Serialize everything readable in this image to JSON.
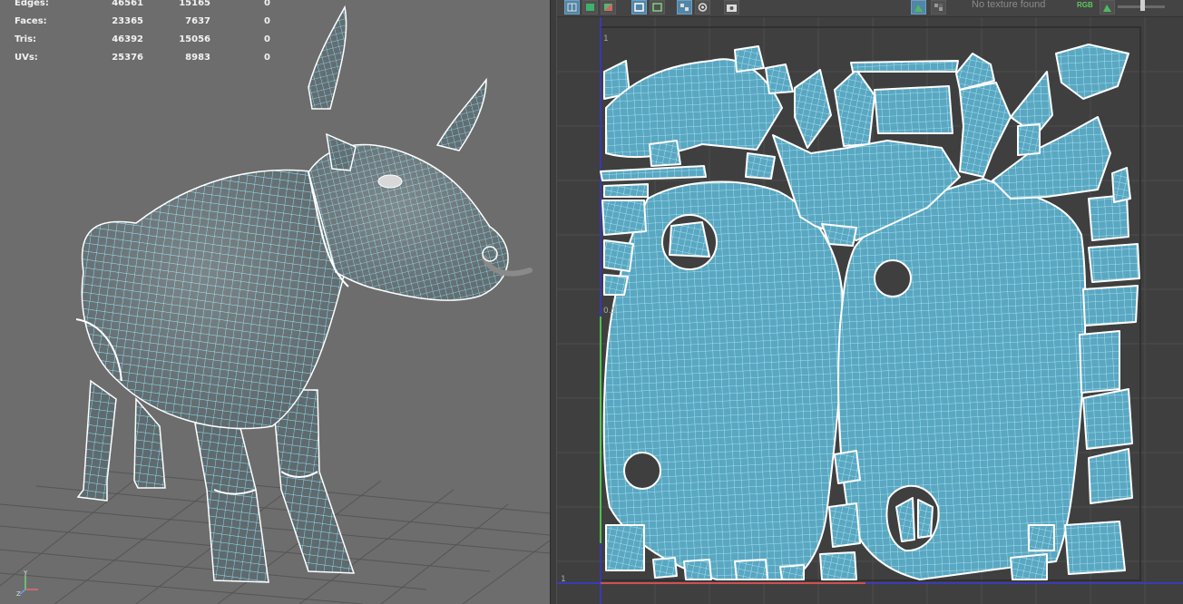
{
  "viewport": {
    "stats": [
      {
        "label": "Edges:",
        "c1": "46561",
        "c2": "15165",
        "c3": "0"
      },
      {
        "label": "Faces:",
        "c1": "23365",
        "c2": "7637",
        "c3": "0"
      },
      {
        "label": "Tris:",
        "c1": "46392",
        "c2": "15056",
        "c3": "0"
      },
      {
        "label": "UVs:",
        "c1": "25376",
        "c2": "8983",
        "c3": "0"
      }
    ],
    "axis": {
      "y": "Y",
      "x": "X",
      "z": "Z"
    }
  },
  "uv_editor": {
    "texture_status": "No texture found",
    "channel_label": "RGB",
    "ticks": {
      "top_one": "1",
      "half": "0.5",
      "bottom_one": "1"
    }
  },
  "colors": {
    "wire": "#8fe6f7",
    "border": "#ffffff",
    "viewport_bg": "#6d6d6d",
    "uv_bg": "#3f3f3f",
    "accent": "#5285a6"
  },
  "icons": [
    "grid-toggle-icon",
    "shaded-uv-icon",
    "distortion-icon",
    "uv-border-icon",
    "checker-icon",
    "snapshot-icon",
    "texture-icon",
    "rgb-channel-icon"
  ]
}
